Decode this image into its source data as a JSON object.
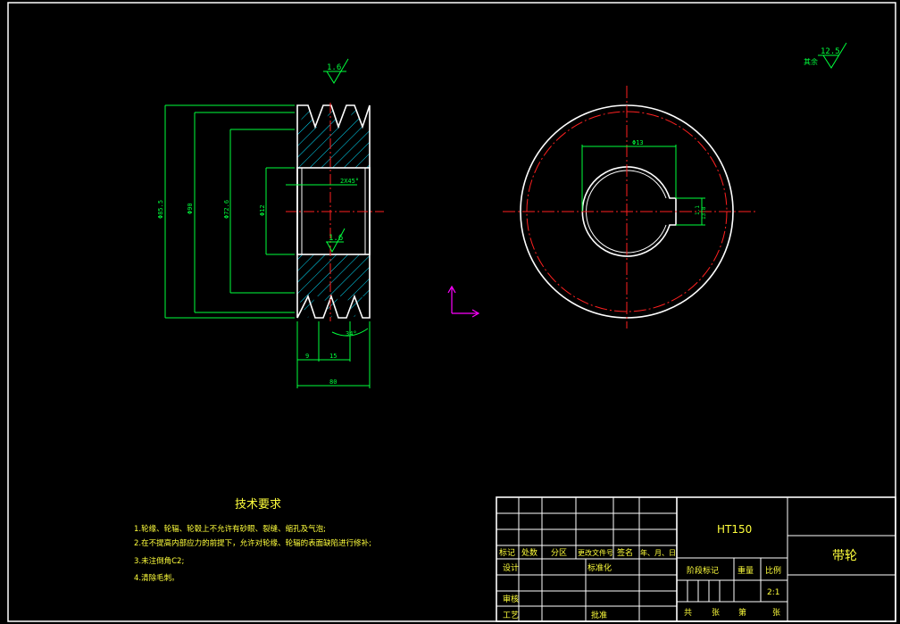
{
  "surface_finish": {
    "remaining_label": "其余",
    "remaining_value": "12.5",
    "groove_value": "1.6",
    "bore_value": "1.6"
  },
  "dimensions": {
    "dia_outer": "Φ85.5",
    "dia_90": "Φ90",
    "dia_72": "Φ72.6",
    "dia_bore": "Φ12",
    "chamfer": "2X45°",
    "width_9": "9",
    "width_15": "15",
    "width_total": "80",
    "groove_angle": "34°",
    "keyway_width": "Φ13",
    "keyway_depth_a": "1.1",
    "keyway_depth_b": "13.8"
  },
  "tech_requirements": {
    "title": "技术要求",
    "items": [
      "1.轮缘、轮辐、轮毂上不允许有砂眼、裂缝、缩孔及气泡;",
      "2.在不提高内部应力的前提下，允许对轮缘、轮辐的表面缺陷进行修补;",
      "3.未注倒角C2;",
      "4.清除毛刺。"
    ]
  },
  "title_block": {
    "material": "HT150",
    "part_name": "带轮",
    "header": [
      "标记",
      "处数",
      "分区",
      "更改文件号",
      "签名",
      "年、月、日"
    ],
    "design": "设计",
    "standardization": "标准化",
    "review": "审核",
    "process": "工艺",
    "approve": "批准",
    "stage_mark": "阶段标记",
    "weight": "重量",
    "scale_label": "比例",
    "scale_value": "2:1",
    "sheet_total": "共",
    "sheet_unit_1": "张",
    "sheet_no": "第",
    "sheet_unit_2": "张"
  }
}
